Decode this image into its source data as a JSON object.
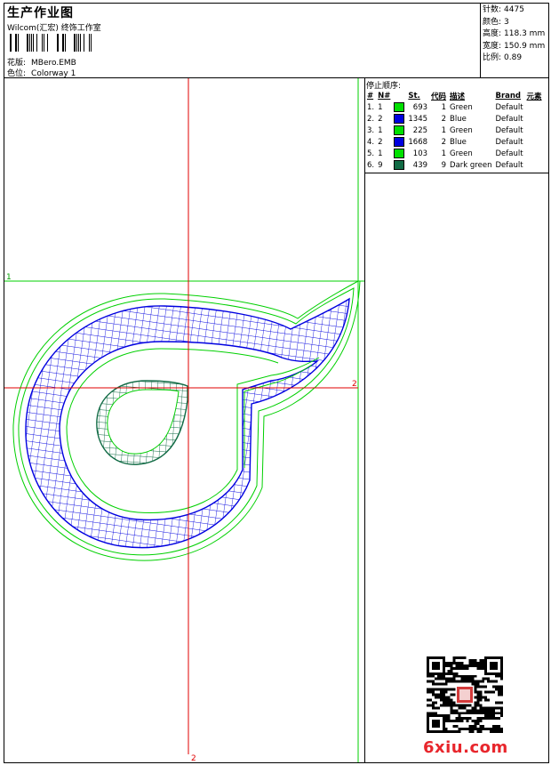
{
  "header": {
    "title": "生产作业图",
    "subtitle": "Wilcom(汇宏) 终饰工作室",
    "design_label": "花版:",
    "design_value": "MBero.EMB",
    "colorway_label": "色位:",
    "colorway_value": "Colorway 1"
  },
  "stats": [
    {
      "label": "针数:",
      "value": "4475"
    },
    {
      "label": "颜色:",
      "value": "3"
    },
    {
      "label": "高度:",
      "value": "118.3 mm"
    },
    {
      "label": "宽度:",
      "value": "150.9 mm"
    },
    {
      "label": "比例:",
      "value": "0.89"
    }
  ],
  "stop_panel": {
    "title": "停止顺序:",
    "headers": {
      "num": "#",
      "n": "N#",
      "st": "St.",
      "code": "代码",
      "desc": "描述",
      "brand": "Brand",
      "elem": "元素"
    },
    "rows": [
      {
        "idx": "1.",
        "n": "1",
        "st": "693",
        "code": "1",
        "desc": "Green",
        "brand": "Default",
        "color": "#00e000"
      },
      {
        "idx": "2.",
        "n": "2",
        "st": "1345",
        "code": "2",
        "desc": "Blue",
        "brand": "Default",
        "color": "#0000e0"
      },
      {
        "idx": "3.",
        "n": "1",
        "st": "225",
        "code": "1",
        "desc": "Green",
        "brand": "Default",
        "color": "#00e000"
      },
      {
        "idx": "4.",
        "n": "2",
        "st": "1668",
        "code": "2",
        "desc": "Blue",
        "brand": "Default",
        "color": "#0000e0"
      },
      {
        "idx": "5.",
        "n": "1",
        "st": "103",
        "code": "1",
        "desc": "Green",
        "brand": "Default",
        "color": "#00e000"
      },
      {
        "idx": "6.",
        "n": "9",
        "st": "439",
        "code": "9",
        "desc": "Dark green",
        "brand": "Default",
        "color": "#116b45"
      }
    ]
  },
  "canvas": {
    "guide_labels": {
      "left": "1",
      "right": "2",
      "bottom": "2"
    }
  },
  "watermark": {
    "text": "6xiu.com",
    "color": "#e8262c"
  },
  "colors": {
    "green": "#00d000",
    "blue": "#0000e0",
    "dark_green": "#116b45",
    "red": "#e00000"
  }
}
